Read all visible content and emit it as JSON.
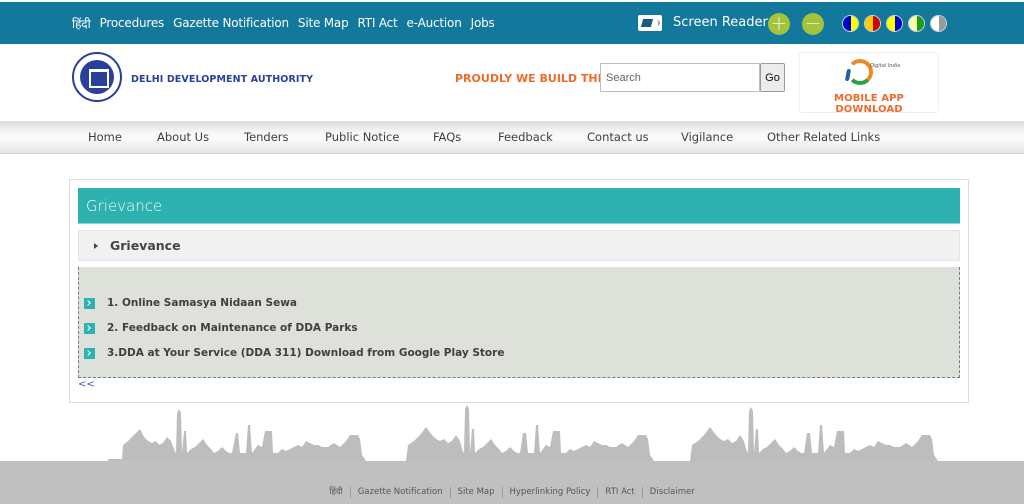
{
  "topbar": {
    "links": [
      "हिंदी",
      "Procedures",
      "Gazette Notification",
      "Site Map",
      "RTI Act",
      "e-Auction",
      "Jobs"
    ],
    "screen_reader_label": "Screen Reader",
    "increase_font_label": "+",
    "decrease_font_label": "−",
    "theme_colors": [
      {
        "name": "blue-yellow",
        "left": "#0000c8",
        "right": "#ffff00"
      },
      {
        "name": "yellow-red",
        "left": "#ffcc00",
        "right": "#d00000"
      },
      {
        "name": "yellow-blue",
        "left": "#ffff00",
        "right": "#0000c8"
      },
      {
        "name": "lightyellow-green",
        "left": "#ffffb0",
        "right": "#1a9e1a"
      },
      {
        "name": "white-gray",
        "left": "#ffffff",
        "right": "#9a9a9a"
      }
    ]
  },
  "header": {
    "org_name": "DELHI DEVELOPMENT AUTHORITY",
    "tagline": "PROUDLY WE BUILD THE CAPITAL",
    "search_placeholder": "Search",
    "search_button": "Go",
    "digital_india_text": "Digital India",
    "app_download_label": "MOBILE APP DOWNLOAD"
  },
  "nav": {
    "items": [
      "Home",
      "About Us",
      "Tenders",
      "Public Notice",
      "FAQs",
      "Feedback",
      "Contact us",
      "Vigilance",
      "Other Related Links"
    ]
  },
  "main": {
    "panel_title": "Grievance",
    "accordion_title": "Grievance",
    "items": [
      "1. Online Samasya Nidaan Sewa",
      "2. Feedback on Maintenance of DDA Parks",
      "3.DDA at Your Service (DDA 311) Download from Google Play Store"
    ],
    "back_link": "<<"
  },
  "footer": {
    "links": [
      "हिंदी",
      "Gazette Notification",
      "Site Map",
      "Hyperlinking Policy",
      "RTI Act",
      "Disclaimer"
    ]
  },
  "colors": {
    "topbar_bg": "#12799c",
    "accent_teal": "#2db1b1",
    "tagline_orange": "#f26a2b",
    "org_blue": "#2b3f9c",
    "zoom_green": "#a4c33a",
    "footer_gray": "#c0c0c0"
  }
}
